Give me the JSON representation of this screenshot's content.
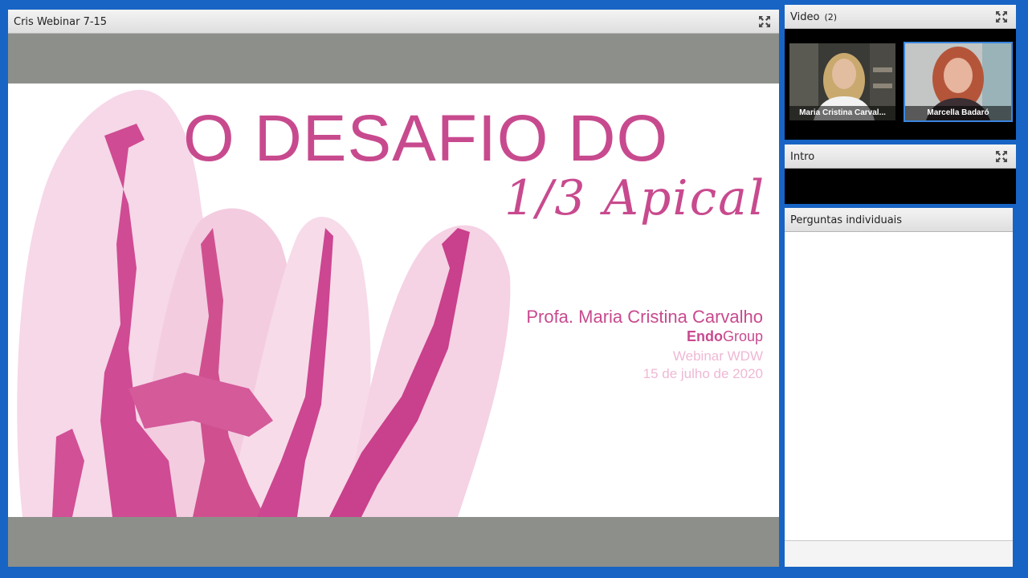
{
  "share_pod": {
    "title": "Cris Webinar 7-15",
    "fullscreen_icon": "fullscreen-icon"
  },
  "slide": {
    "title": "O DESAFIO DO",
    "subtitle": "1/3 Apical",
    "author": "Profa. Maria Cristina Carvalho",
    "group_bold": "Endo",
    "group_rest": "Group",
    "event": "Webinar WDW",
    "date": "15 de julho de 2020",
    "colors": {
      "primary": "#c84a8e",
      "light": "#efb8d4"
    }
  },
  "video_pod": {
    "title": "Video",
    "count": "(2)",
    "participants": [
      {
        "name": "Maria Cristina Carval..."
      },
      {
        "name": "Marcella Badaró"
      }
    ]
  },
  "intro_pod": {
    "title": "Intro"
  },
  "questions_pod": {
    "title": "Perguntas individuais"
  },
  "colors": {
    "background": "#1764c4",
    "active_speaker_border": "#3a86e0"
  }
}
